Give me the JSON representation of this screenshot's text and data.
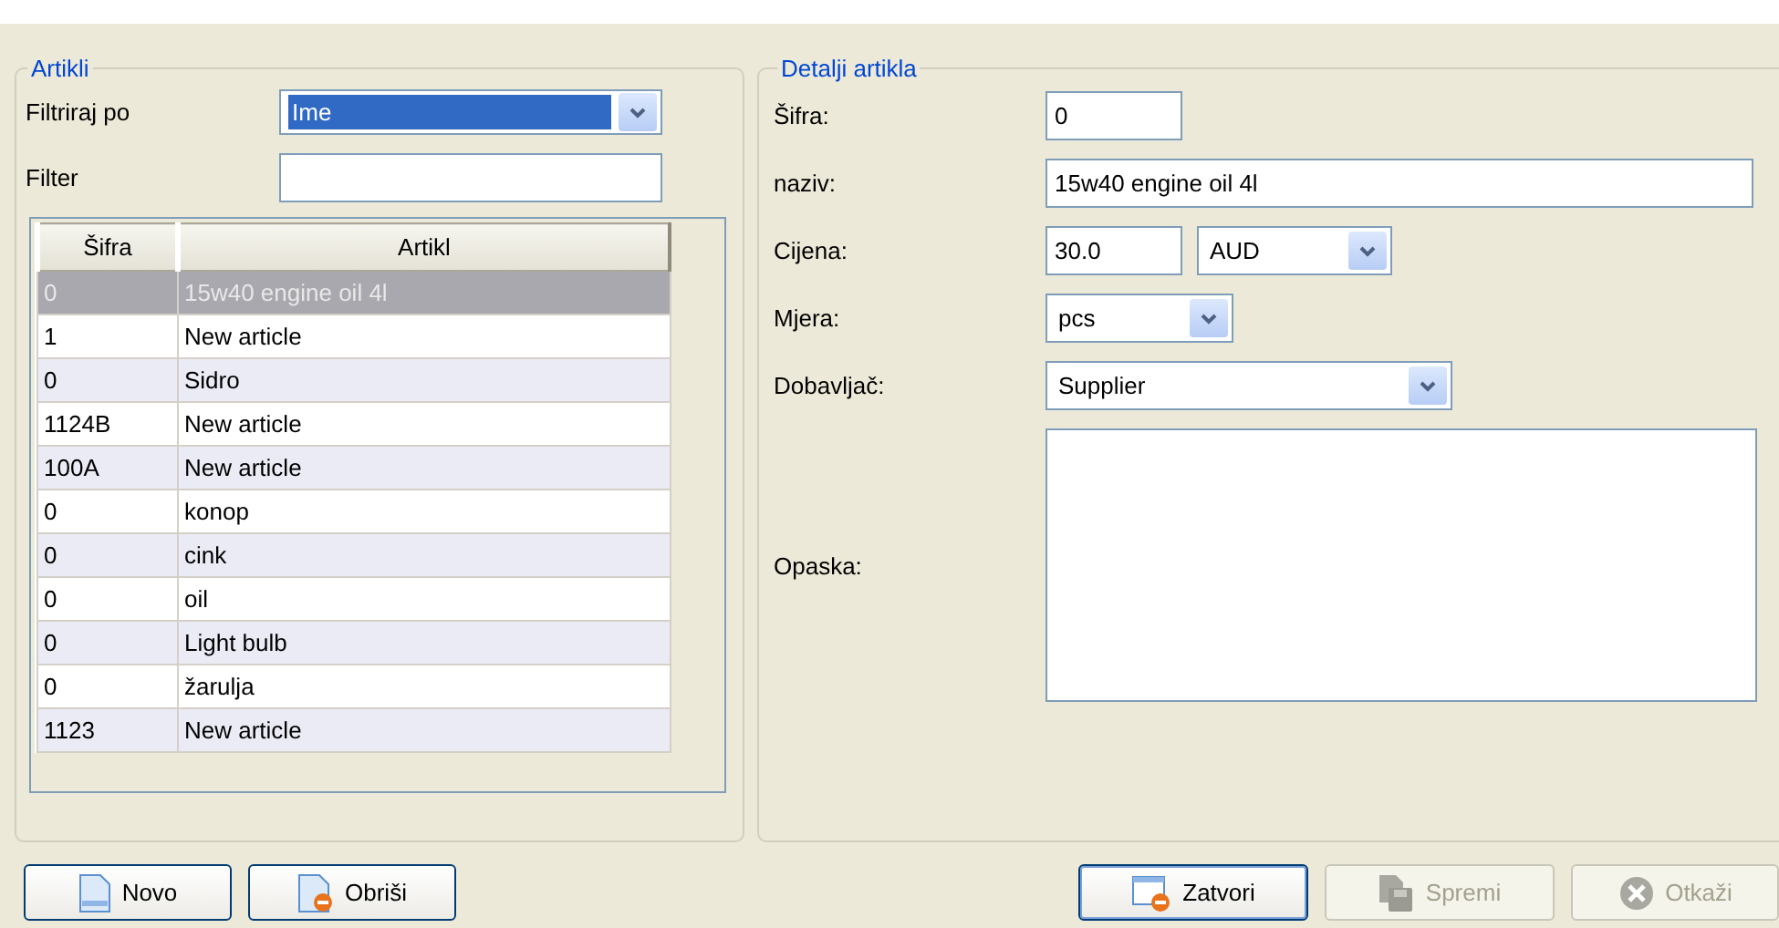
{
  "articles": {
    "title": "Artikli",
    "filter_by": {
      "label": "Filtriraj po",
      "value": "Ime",
      "focused": true
    },
    "filter": {
      "label": "Filter"
    },
    "table": {
      "columns": [
        "Šifra",
        "Artikl"
      ],
      "rows": [
        {
          "cells": [
            "0",
            "15w40 engine oil 4l"
          ],
          "selected": true
        },
        {
          "cells": [
            "1",
            "New article"
          ],
          "selected": false
        },
        {
          "cells": [
            "0",
            "Sidro"
          ],
          "selected": false
        },
        {
          "cells": [
            "1124B",
            "New article"
          ],
          "selected": false
        },
        {
          "cells": [
            "100A",
            "New article"
          ],
          "selected": false
        },
        {
          "cells": [
            "0",
            "konop"
          ],
          "selected": false
        },
        {
          "cells": [
            "0",
            "cink"
          ],
          "selected": false
        },
        {
          "cells": [
            "0",
            "oil"
          ],
          "selected": false
        },
        {
          "cells": [
            "0",
            "Light bulb"
          ],
          "selected": false
        },
        {
          "cells": [
            "0",
            "žarulja"
          ],
          "selected": false
        },
        {
          "cells": [
            "1123",
            "New article"
          ],
          "selected": false
        }
      ]
    }
  },
  "details": {
    "title": "Detalji artikla",
    "fields": [
      {
        "kind": "short",
        "label": "Šifra:",
        "value": "0"
      },
      {
        "kind": "long",
        "label": "naziv:",
        "value": "15w40 engine oil 4l"
      },
      {
        "kind": "price",
        "label": "Cijena:",
        "value": "30.0",
        "currency": "AUD"
      },
      {
        "kind": "combo",
        "label": "Mjera:",
        "value": "pcs"
      },
      {
        "kind": "combo",
        "label": "Dobavljač:",
        "value": "Supplier"
      },
      {
        "kind": "memo",
        "label": "Opaska:"
      }
    ]
  },
  "left_buttons": [
    {
      "label": "Novo",
      "kind": "new",
      "disabled": false,
      "default": false
    },
    {
      "label": "Obriši",
      "kind": "delete",
      "disabled": false,
      "default": false
    }
  ],
  "right_buttons": [
    {
      "label": "Zatvori",
      "kind": "close",
      "disabled": false,
      "default": true
    },
    {
      "label": "Spremi",
      "kind": "save",
      "disabled": true,
      "default": false
    },
    {
      "label": "Otkaži",
      "kind": "cancel",
      "disabled": true,
      "default": false
    }
  ]
}
